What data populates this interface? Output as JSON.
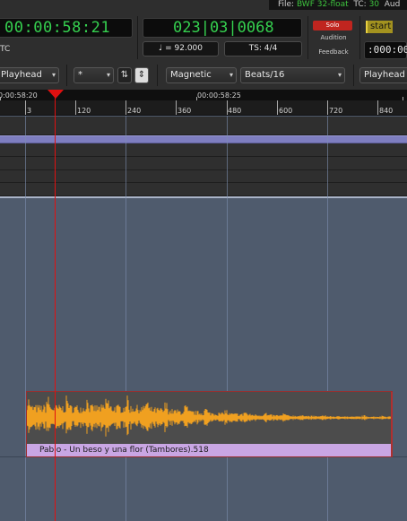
{
  "header": {
    "file_label": "File: ",
    "file_format": "BWF 32-float",
    "tc_label": "TC: ",
    "tc_value": "30",
    "aud_label": "Aud"
  },
  "transport": {
    "timecode": "00:00:58:21",
    "timecode_label": "TC",
    "bbt": "023|03|0068",
    "tempo": "♩ = 92.000",
    "meter": "TS: 4/4",
    "solo": "Solo",
    "audition": "Audition",
    "feedback": "Feedback",
    "start": "start",
    "mini_clock": ":000:00"
  },
  "edit_bar": {
    "edit_point": "Playhead",
    "nudge": "*",
    "snap_mode": "Magnetic",
    "grid": "Beats/16",
    "edit_point_right": "Playhead"
  },
  "rulers": {
    "timecode_ticks": [
      "0:00:58:20",
      "00:00:58:25"
    ],
    "bbt_ticks": [
      "3",
      "120",
      "240",
      "360",
      "480",
      "600",
      "720",
      "840"
    ]
  },
  "region": {
    "name": "Pablo - Un beso y una flor (Tambores).518",
    "waveform_color": "#f0a020",
    "name_bar_color": "#c9a6e4"
  },
  "colors": {
    "playhead": "#e01010",
    "clock_text": "#35d04f",
    "track_bg": "#4f5b6d",
    "range_bar": "#7e7ec0"
  },
  "icons": {
    "playhead_marker": "triangle-down",
    "nudge_clock": "clock-icon",
    "nudge_button": "nudge-icon",
    "dropdown_arrow": "chevron-down-icon"
  }
}
